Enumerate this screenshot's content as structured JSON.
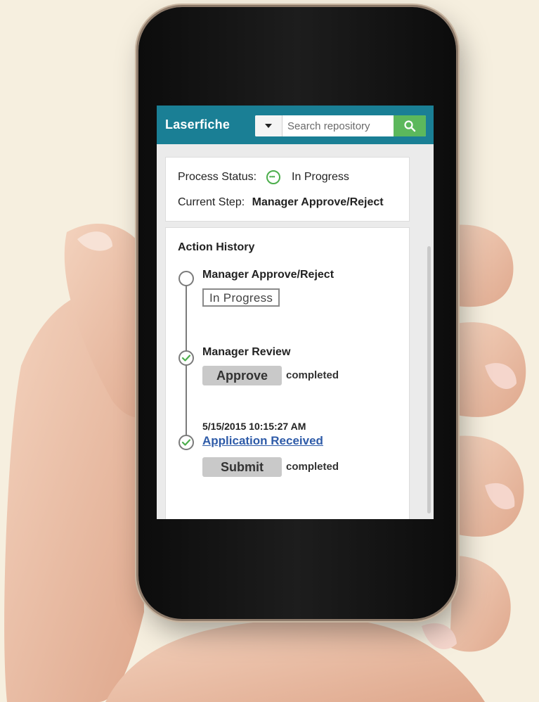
{
  "app": {
    "brand": "Laserfiche",
    "search_placeholder": "Search repository"
  },
  "status": {
    "label": "Process Status:",
    "value": "In Progress",
    "step_label": "Current Step:",
    "step_value": "Manager Approve/Reject"
  },
  "history": {
    "title": "Action History",
    "items": [
      {
        "title": "Manager Approve/Reject",
        "badge": "In Progress"
      },
      {
        "title": "Manager Review",
        "action": "Approve",
        "status": "completed"
      },
      {
        "timestamp": "5/15/2015  10:15:27 AM",
        "title": "Application Received",
        "action": "Submit",
        "status": "completed"
      }
    ]
  },
  "colors": {
    "header": "#1a7f95",
    "search_button": "#5cb85c",
    "check": "#4cae4c",
    "link": "#2e5ba8"
  },
  "icons": [
    "caret-down-icon",
    "search-icon",
    "in-progress-icon",
    "circle-icon",
    "check-icon"
  ]
}
